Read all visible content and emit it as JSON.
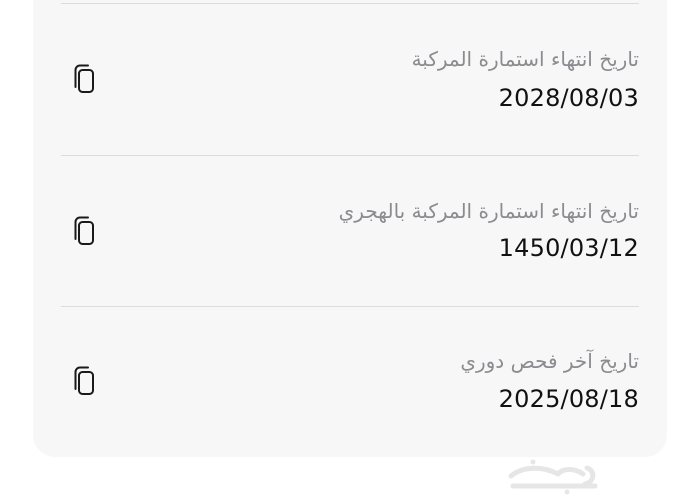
{
  "details": {
    "items": [
      {
        "label": "تاريخ انتهاء استمارة المركبة",
        "value": "2028/08/03",
        "copy_icon": "copy-icon"
      },
      {
        "label": "تاريخ انتهاء استمارة المركبة بالهجري",
        "value": "1450/03/12",
        "copy_icon": "copy-icon"
      },
      {
        "label": "تاريخ آخر فحص دوري",
        "value": "2025/08/18",
        "copy_icon": "copy-icon"
      }
    ]
  },
  "watermark": {
    "text": "حراج"
  },
  "colors": {
    "card_background": "#f7f7f8",
    "label_text": "#8b8b90",
    "value_text": "#111111",
    "divider": "#dcdcdf",
    "icon_stroke": "#1a1a1a"
  }
}
